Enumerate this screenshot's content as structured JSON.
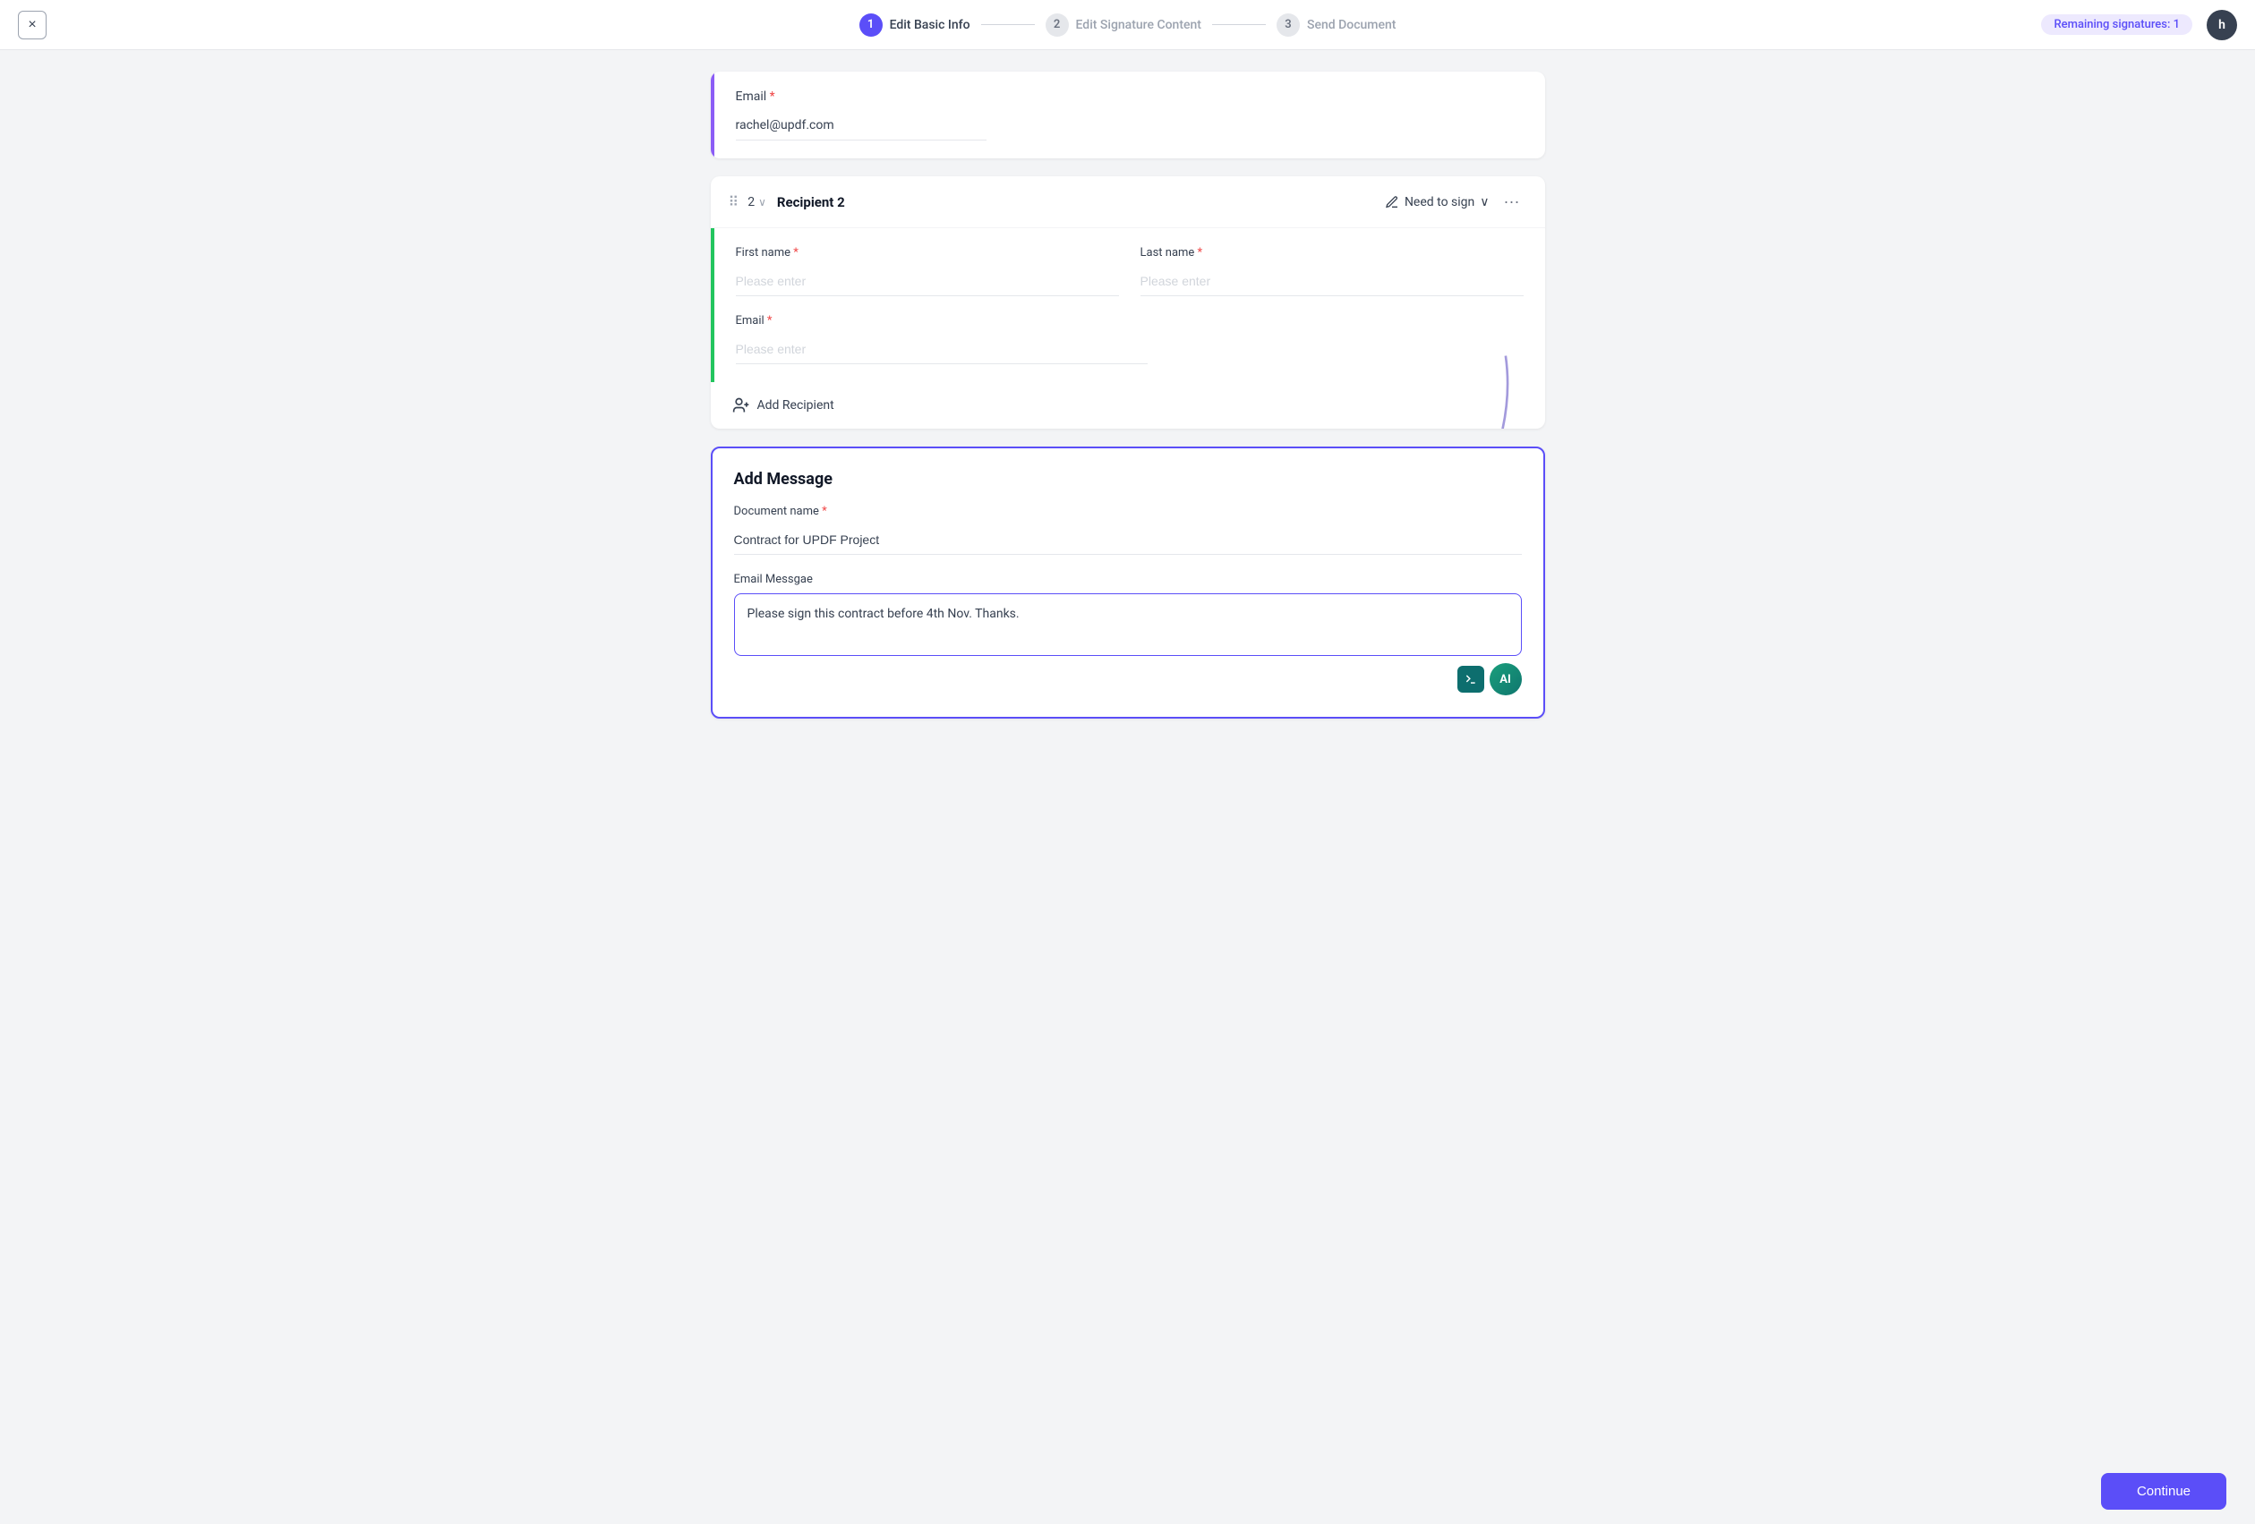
{
  "header": {
    "close_label": "×",
    "steps": [
      {
        "number": "1",
        "label": "Edit Basic Info",
        "active": true
      },
      {
        "number": "2",
        "label": "Edit Signature Content",
        "active": false
      },
      {
        "number": "3",
        "label": "Send Document",
        "active": false
      }
    ],
    "remaining_label": "Remaining signatures: 1",
    "avatar_letter": "h"
  },
  "recipient1": {
    "email_label": "Email",
    "email_value": "rachel@updf.com"
  },
  "recipient2": {
    "number": "2",
    "chevron": "∨",
    "title": "Recipient 2",
    "need_to_sign_label": "Need to sign",
    "chevron_down": "∨",
    "more": "···",
    "first_name_label": "First name",
    "last_name_label": "Last name",
    "first_name_placeholder": "Please enter",
    "last_name_placeholder": "Please enter",
    "email_label": "Email",
    "email_placeholder": "Please enter"
  },
  "add_recipient": {
    "label": "Add Recipient"
  },
  "add_message": {
    "title": "Add Message",
    "doc_name_label": "Document name",
    "doc_name_required": true,
    "doc_name_value": "Contract for UPDF Project",
    "email_message_label": "Email Messgae",
    "email_message_value": "Please sign this contract before 4th Nov. Thanks."
  },
  "footer": {
    "continue_label": "Continue"
  }
}
